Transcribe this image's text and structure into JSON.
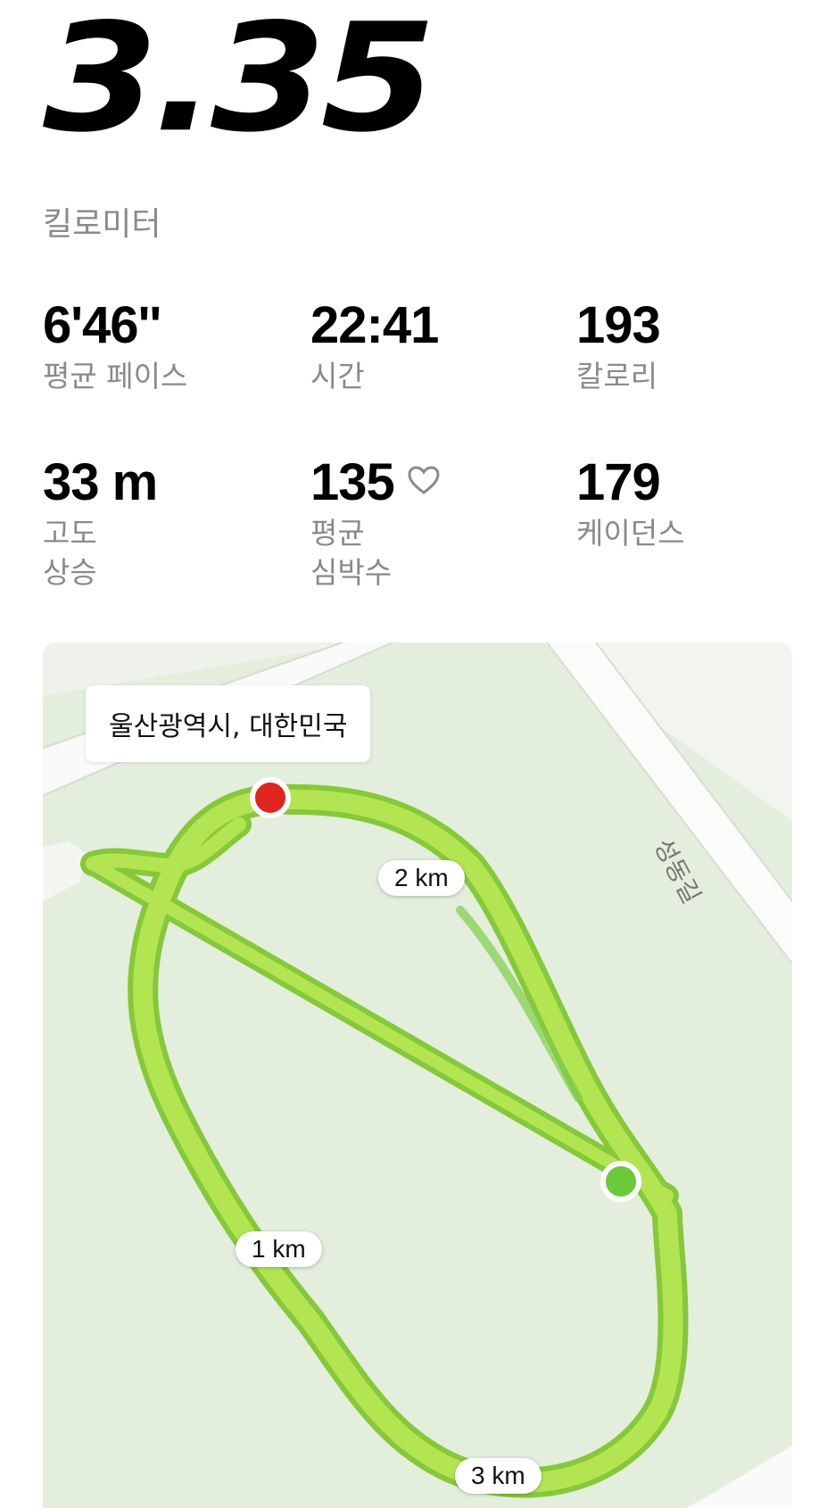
{
  "summary": {
    "distance": "3.35",
    "unit": "킬로미터"
  },
  "stats": {
    "pace": {
      "value": "6'46''",
      "label": "평균 페이스"
    },
    "time": {
      "value": "22:41",
      "label": "시간"
    },
    "calories": {
      "value": "193",
      "label": "칼로리"
    },
    "elevation": {
      "value": "33 m",
      "label": "고도\n상승"
    },
    "heart_rate": {
      "value": "135",
      "label": "평균\n심박수",
      "icon": "heart-icon"
    },
    "cadence": {
      "value": "179",
      "label": "케이던스"
    }
  },
  "map": {
    "location": "울산광역시, 대한민국",
    "road_name": "성동길",
    "km_markers": [
      "1 km",
      "2 km",
      "3 km"
    ],
    "colors": {
      "background": "#e3eedd",
      "route": "#a8e04a",
      "route_outline": "#86c83a",
      "start": "#6bc93c",
      "end": "#e0271f"
    }
  }
}
